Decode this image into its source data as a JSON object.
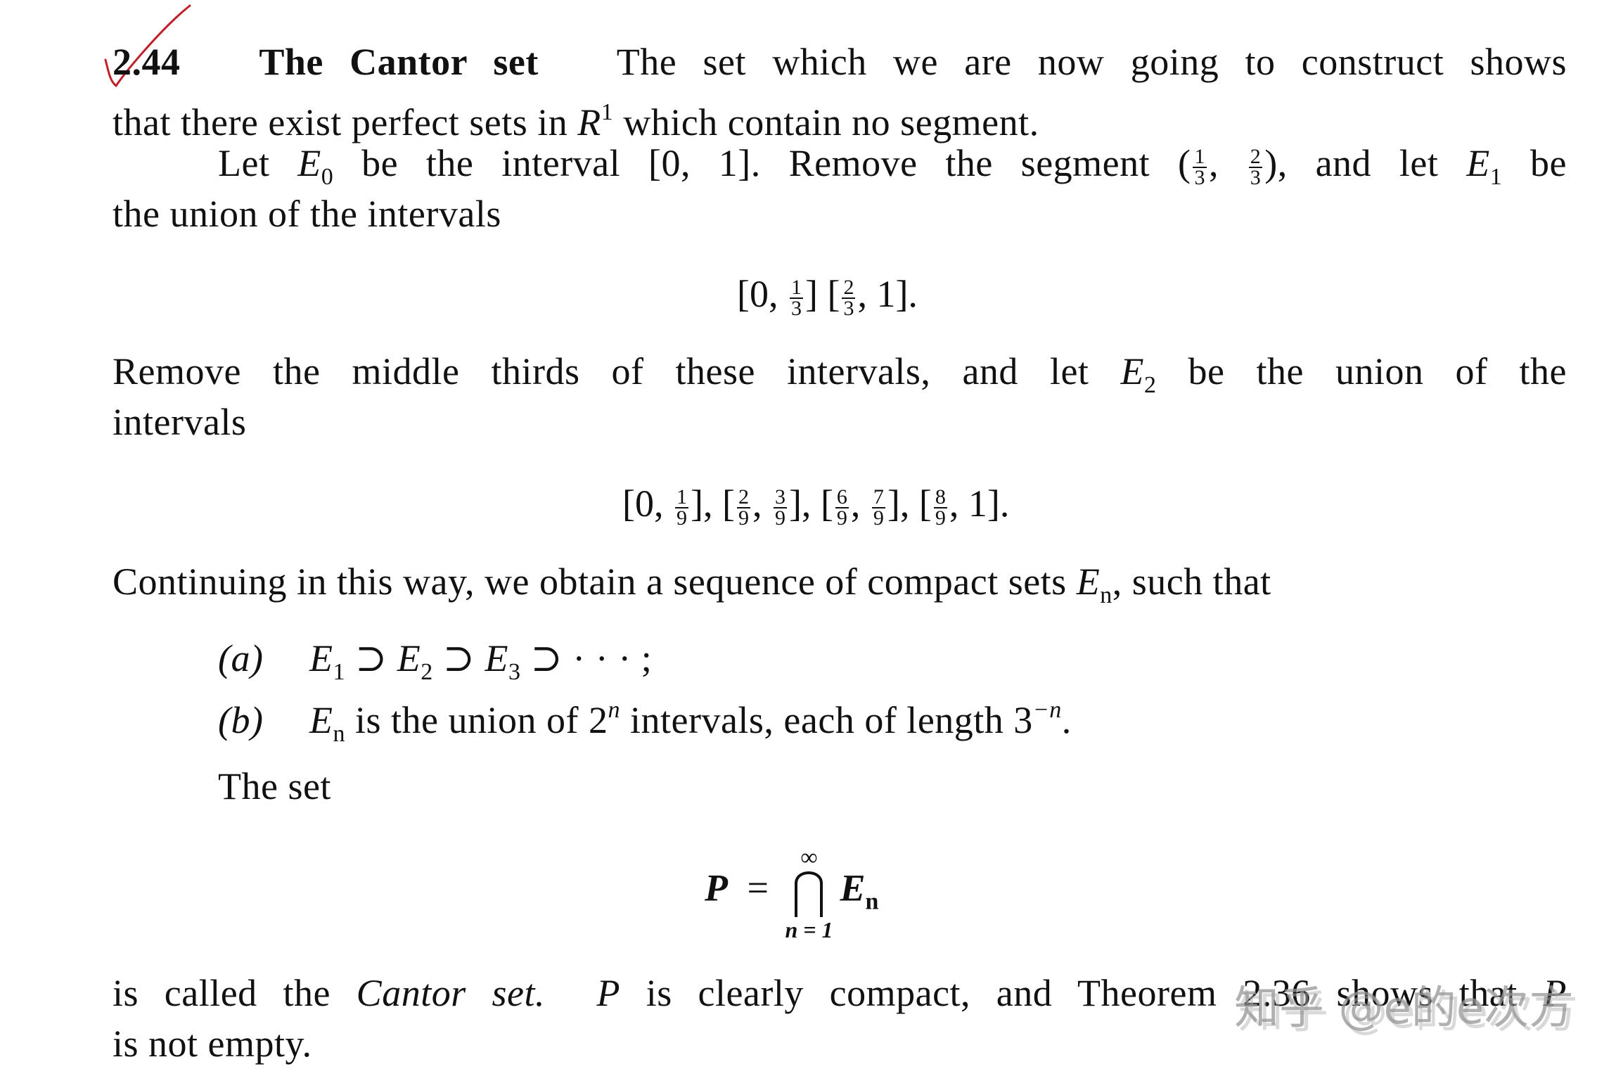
{
  "section": {
    "number": "2.44",
    "title": "The Cantor set",
    "p1_rest_line1": "The set which we are now going to construct shows",
    "p1_line2_a": "that there exist perfect sets in ",
    "p1_line2_R": "R",
    "p1_line2_sup": "1",
    "p1_line2_b": " which contain no segment.",
    "p2_let": "Let ",
    "E": "E",
    "sub0": "0",
    "p2_a": " be the interval [0, 1].  Remove the segment (",
    "third_num1": "1",
    "third_den": "3",
    "third_num2": "2",
    "p2_b": "), and let ",
    "sub1": "1",
    "p2_c": " be",
    "p2_line2": "the union of the intervals",
    "display1": {
      "open1": "[0, ",
      "close1": "]  [",
      "close2": ", 1]."
    },
    "p3_a": "Remove the middle thirds of these intervals, and let ",
    "sub2": "2",
    "p3_b": " be the union of the",
    "p3_line2": "intervals",
    "display2": {
      "den": "9",
      "intervals": [
        {
          "left": "0",
          "right": "1"
        },
        {
          "left": "2",
          "right": "3"
        },
        {
          "left": "6",
          "right": "7"
        },
        {
          "left": "8",
          "right": "1"
        }
      ]
    },
    "p4_a": "Continuing in this way, we obtain a sequence of compact sets ",
    "subn": "n",
    "p4_b": ", such that",
    "items": {
      "a_label": "(a)",
      "a_text_sup": "⊃",
      "sub3": "3",
      "a_tail": " ⊃ · · · ;",
      "b_label": "(b)",
      "b_text1": " is the union of 2",
      "b_sup1": "n",
      "b_text2": " intervals, each of length 3",
      "b_sup2": "−n",
      "b_text3": "."
    },
    "the_set": "The set",
    "formula": {
      "lhs": "P",
      "eq": "=",
      "upper": "∞",
      "lower": "n = 1",
      "rhs_E": "E",
      "rhs_sub": "n"
    },
    "p5_a": "is called the ",
    "p5_it": "Cantor set.",
    "p5_P": "P",
    "p5_b": " is clearly compact, and Theorem 2.36 shows that ",
    "p5_P2": "P",
    "p5_line2": "is not empty."
  },
  "annotation": {
    "checkmark_color": "#c0202a"
  },
  "watermark": "知乎 @e的e次方"
}
